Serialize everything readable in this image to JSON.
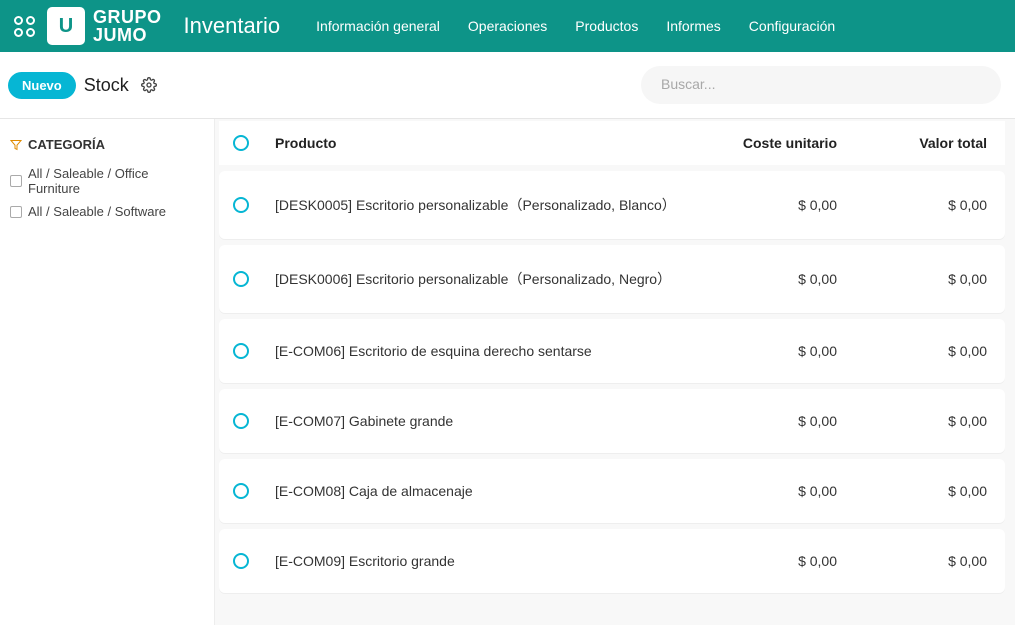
{
  "header": {
    "brand_line1": "GRUPO",
    "brand_line2": "JUMO",
    "app_name": "Inventario",
    "nav": [
      "Información general",
      "Operaciones",
      "Productos",
      "Informes",
      "Configuración"
    ]
  },
  "subheader": {
    "new_label": "Nuevo",
    "breadcrumb": "Stock",
    "search_placeholder": "Buscar..."
  },
  "sidebar": {
    "filter_title": "CATEGORÍA",
    "filters": [
      "All / Saleable / Office Furniture",
      "All / Saleable / Software"
    ]
  },
  "table": {
    "columns": {
      "product": "Producto",
      "unit_cost": "Coste unitario",
      "total_value": "Valor total"
    },
    "rows": [
      {
        "product": "[DESK0005] Escritorio personalizable（Personalizado, Blanco）",
        "unit_cost": "$ 0,00",
        "total_value": "$ 0,00"
      },
      {
        "product": "[DESK0006] Escritorio personalizable（Personalizado, Negro）",
        "unit_cost": "$ 0,00",
        "total_value": "$ 0,00"
      },
      {
        "product": "[E-COM06] Escritorio de esquina derecho sentarse",
        "unit_cost": "$ 0,00",
        "total_value": "$ 0,00"
      },
      {
        "product": "[E-COM07] Gabinete grande",
        "unit_cost": "$ 0,00",
        "total_value": "$ 0,00"
      },
      {
        "product": "[E-COM08] Caja de almacenaje",
        "unit_cost": "$ 0,00",
        "total_value": "$ 0,00"
      },
      {
        "product": "[E-COM09] Escritorio grande",
        "unit_cost": "$ 0,00",
        "total_value": "$ 0,00"
      }
    ]
  }
}
